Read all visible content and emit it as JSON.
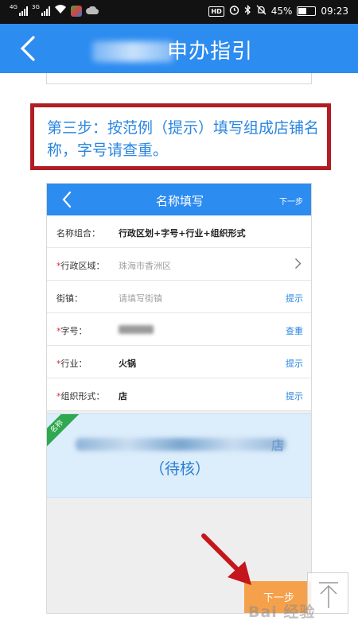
{
  "status_bar": {
    "net_left": "4G",
    "net_right": "3G",
    "battery": "45%",
    "time": "09:23",
    "hd": "HD"
  },
  "header": {
    "title_suffix": "申办指引"
  },
  "step": {
    "text": "第三步：按范例（提示）填写组成店铺名称，字号请查重。"
  },
  "inner_app": {
    "title": "名称填写",
    "next_label": "下一步",
    "form": {
      "name_combo": {
        "label": "名称组合：",
        "value": "行政区划+字号+行业+组织形式"
      },
      "region": {
        "label": "行政区域：",
        "value": "珠海市香洲区"
      },
      "street": {
        "label": "街镇：",
        "placeholder": "请填写街镇",
        "action": "提示"
      },
      "brand": {
        "label": "字号：",
        "action": "查重"
      },
      "industry": {
        "label": "行业：",
        "value": "火锅",
        "action": "提示"
      },
      "org_form": {
        "label": "组织形式：",
        "value": "店",
        "action": "提示"
      }
    },
    "preview": {
      "ribbon": "名称",
      "name_end": "店",
      "status": "（待核）"
    },
    "bottom_button": "下一步"
  },
  "watermark": "Bai 经验",
  "colors": {
    "primary_blue": "#2d8cf0",
    "step_border": "#b01e24",
    "accent_orange": "#f5a04a",
    "required_red": "#e0262e"
  }
}
